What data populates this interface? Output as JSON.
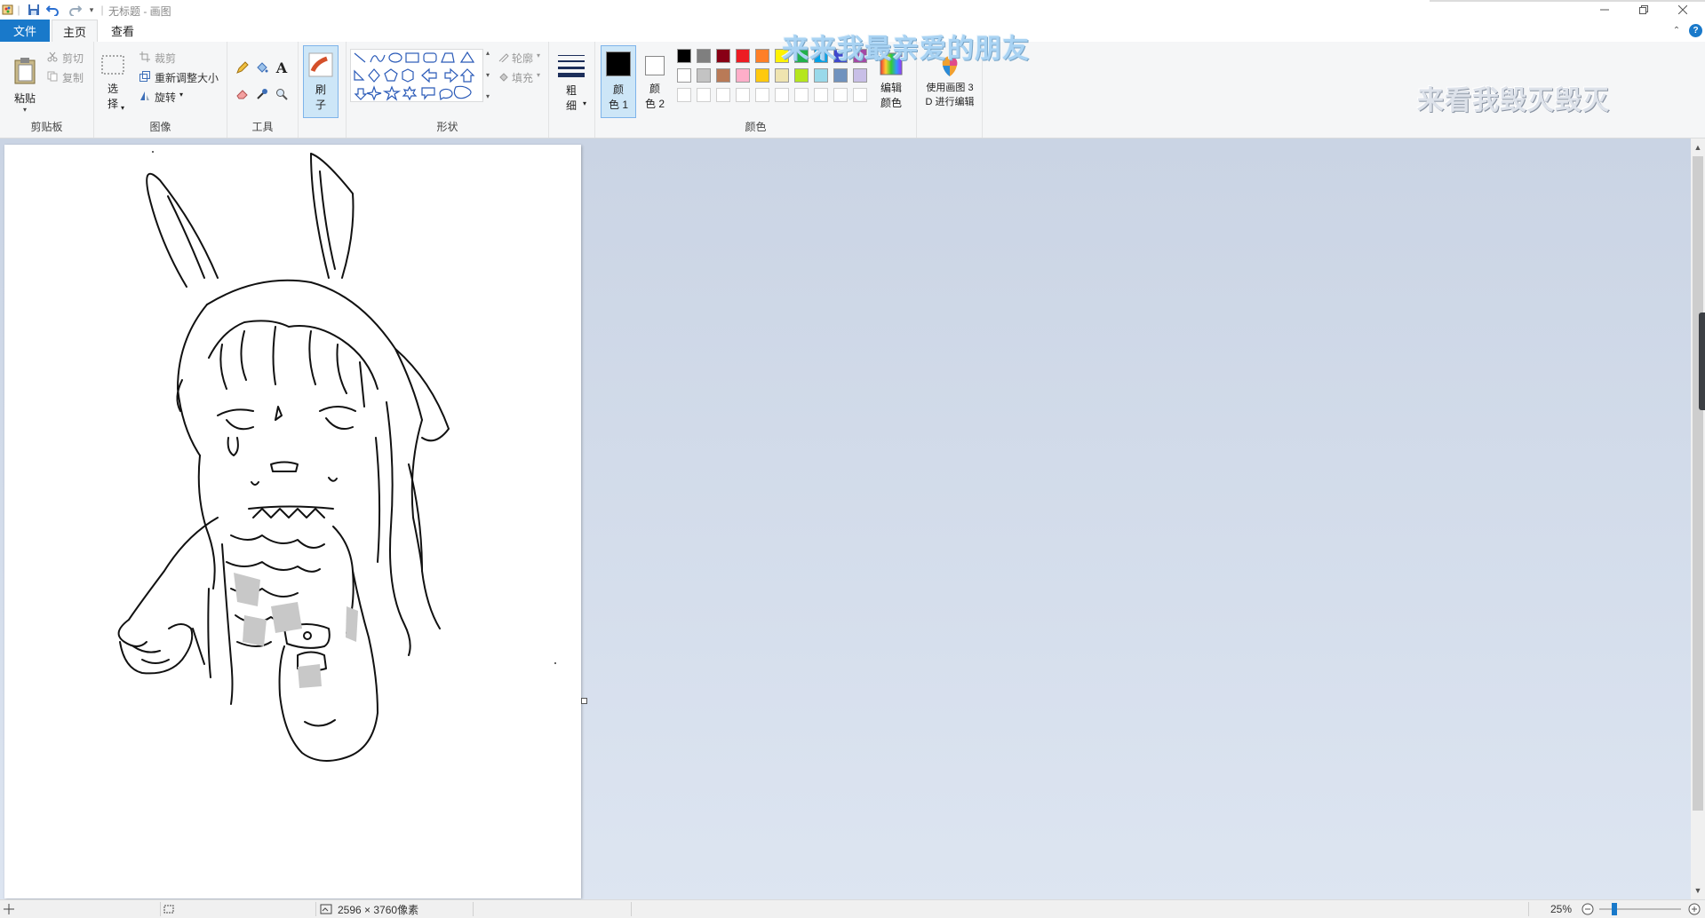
{
  "window": {
    "title": "无标题 - 画图",
    "controls": [
      "minimize",
      "restore",
      "close"
    ]
  },
  "tabs": {
    "file": "文件",
    "home": "主页",
    "view": "查看"
  },
  "ribbon": {
    "clipboard": {
      "label": "剪贴板",
      "paste": "粘贴",
      "cut": "剪切",
      "copy": "复制"
    },
    "image": {
      "label": "图像",
      "select_line1": "选",
      "select_line2": "择",
      "crop": "裁剪",
      "resize": "重新调整大小",
      "rotate": "旋转"
    },
    "tools": {
      "label": "工具"
    },
    "brushes": {
      "line1": "刷",
      "line2": "子"
    },
    "shapes": {
      "label": "形状",
      "outline": "轮廓",
      "fill": "填充"
    },
    "size": {
      "line1": "粗",
      "line2": "细"
    },
    "colors": {
      "label": "颜色",
      "color1_line1": "颜",
      "color1_line2": "色 1",
      "color2_line1": "颜",
      "color2_line2": "色 2",
      "edit_line1": "编辑",
      "edit_line2": "颜色",
      "paint3d_line1": "使用画图 3",
      "paint3d_line2": "D 进行编辑",
      "palette_row1": [
        "#000000",
        "#7f7f7f",
        "#880015",
        "#ed1c24",
        "#ff7f27",
        "#fff200",
        "#22b14c",
        "#00a2e8",
        "#3f48cc",
        "#a349a4"
      ],
      "palette_row2": [
        "#ffffff",
        "#c3c3c3",
        "#b97a57",
        "#ffaec9",
        "#ffc90e",
        "#efe4b0",
        "#b5e61d",
        "#99d9ea",
        "#7092be",
        "#c8bfe7"
      ],
      "palette_row3": [
        "#ffffff",
        "#ffffff",
        "#ffffff",
        "#ffffff",
        "#ffffff",
        "#ffffff",
        "#ffffff",
        "#ffffff",
        "#ffffff",
        "#ffffff"
      ],
      "primary": "#000000",
      "secondary": "#ffffff"
    }
  },
  "overlays": {
    "caption1": "来来我最亲爱的朋友",
    "caption2": "来看我毁灭毁灭"
  },
  "status": {
    "dimensions": "2596 × 3760像素",
    "zoom": "25%"
  }
}
